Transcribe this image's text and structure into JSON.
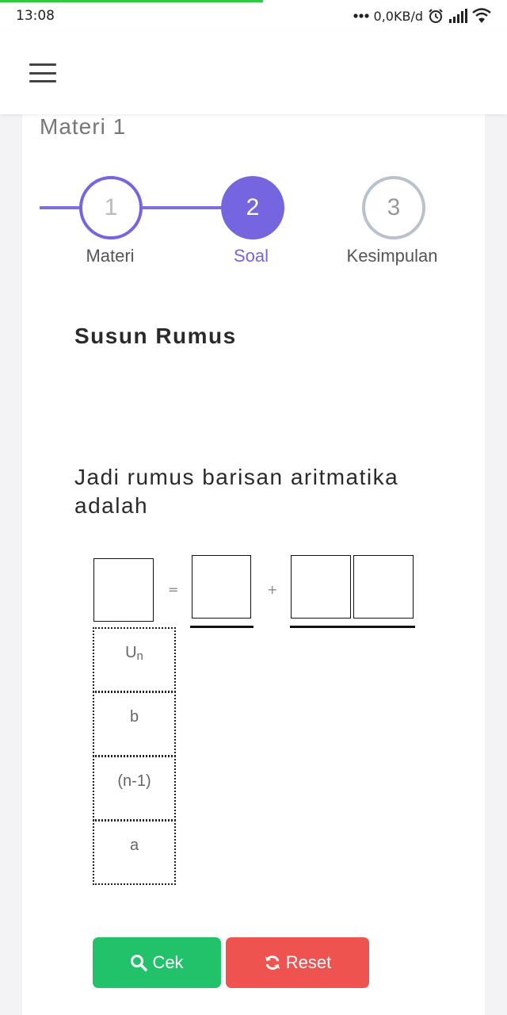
{
  "status_bar": {
    "time": "13:08",
    "network_speed": "0,0KB/d",
    "icons": [
      "dots-icon",
      "alarm-icon",
      "signal-icon",
      "wifi-icon"
    ]
  },
  "app_bar": {
    "menu_icon": "hamburger-icon"
  },
  "page": {
    "title": "Materi 1",
    "steps": [
      {
        "number": "1",
        "label": "Materi",
        "state": "done"
      },
      {
        "number": "2",
        "label": "Soal",
        "state": "active"
      },
      {
        "number": "3",
        "label": "Kesimpulan",
        "state": "todo"
      }
    ],
    "section_title": "Susun Rumus",
    "question": "Jadi rumus barisan aritmatika adalah",
    "formula": {
      "equals": "=",
      "plus": "+"
    },
    "options": [
      {
        "main": "U",
        "sub": "n"
      },
      {
        "main": "b",
        "sub": ""
      },
      {
        "main": "(n-1)",
        "sub": ""
      },
      {
        "main": "a",
        "sub": ""
      }
    ],
    "buttons": {
      "check": "Cek",
      "reset": "Reset"
    }
  },
  "colors": {
    "primary": "#7566e0",
    "check_button": "#22c26b",
    "reset_button": "#ef5350",
    "inactive_step": "#b8c2cc"
  }
}
